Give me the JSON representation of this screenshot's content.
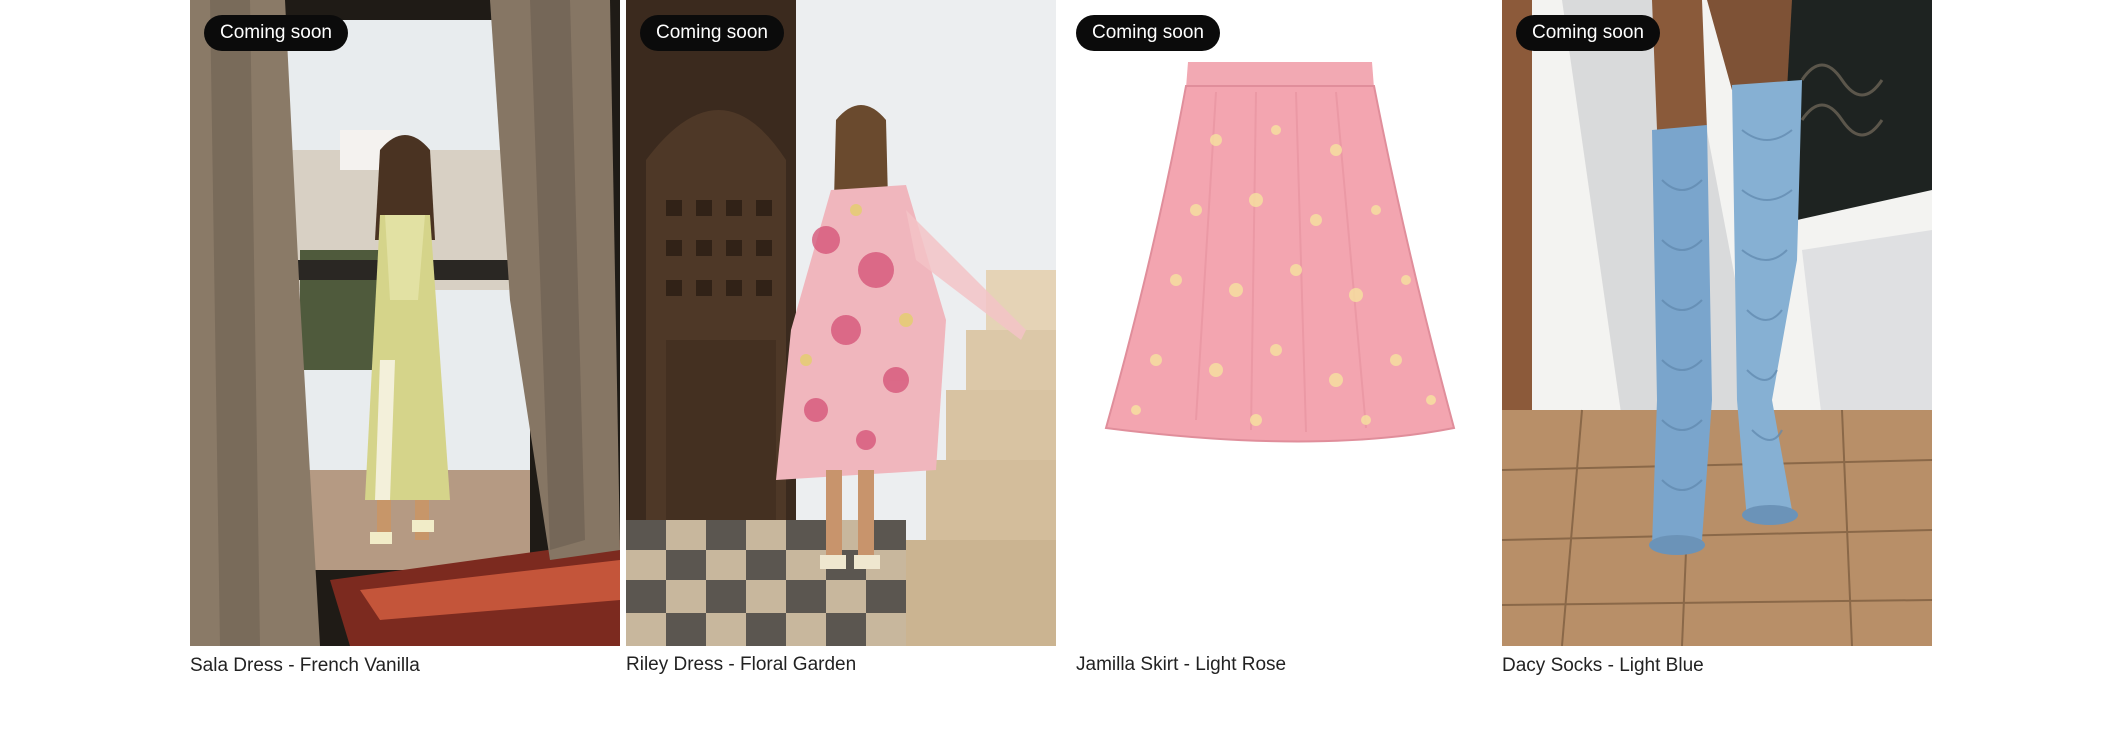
{
  "products": [
    {
      "badge": "Coming soon",
      "name": "Sala Dress - French Vanilla"
    },
    {
      "badge": "Coming soon",
      "name": "Riley Dress - Floral Garden"
    },
    {
      "badge": "Coming soon",
      "name": "Jamilla Skirt - Light Rose"
    },
    {
      "badge": "Coming soon",
      "name": "Dacy Socks - Light Blue"
    }
  ]
}
